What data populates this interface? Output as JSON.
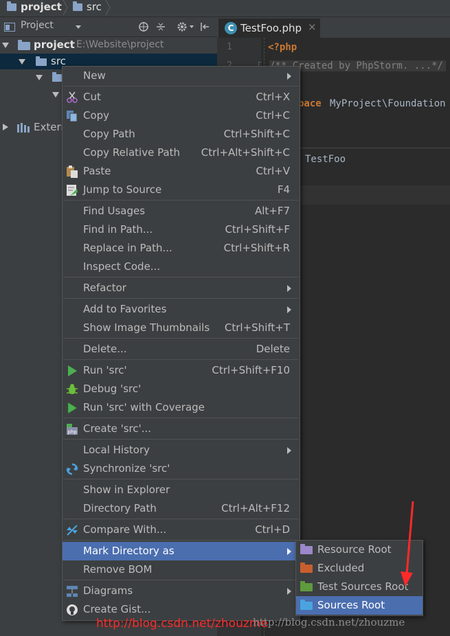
{
  "breadcrumb": {
    "project": "project",
    "src": "src"
  },
  "project_panel": {
    "view_label": "Project",
    "tree": {
      "root_name": "project",
      "root_path": "E:\\Website\\project",
      "src": "src",
      "external": "Extern"
    }
  },
  "editor": {
    "tab_name": "TestFoo.php",
    "tab_icon_letter": "C",
    "line_numbers": [
      "1",
      "2"
    ],
    "code": {
      "open_tag": "<?php",
      "comment": "/** Created by PhpStorm. ...*/",
      "ns_keyword": "pace",
      "ns_name": "MyProject\\Foundation",
      "class_name": "TestFoo"
    }
  },
  "context_menu": {
    "items": [
      {
        "label": "New",
        "shortcut": ""
      },
      {
        "label": "Cut",
        "shortcut": "Ctrl+X"
      },
      {
        "label": "Copy",
        "shortcut": "Ctrl+C"
      },
      {
        "label": "Copy Path",
        "shortcut": "Ctrl+Shift+C"
      },
      {
        "label": "Copy Relative Path",
        "shortcut": "Ctrl+Alt+Shift+C"
      },
      {
        "label": "Paste",
        "shortcut": "Ctrl+V"
      },
      {
        "label": "Jump to Source",
        "shortcut": "F4"
      },
      {
        "label": "Find Usages",
        "shortcut": "Alt+F7"
      },
      {
        "label": "Find in Path...",
        "shortcut": "Ctrl+Shift+F"
      },
      {
        "label": "Replace in Path...",
        "shortcut": "Ctrl+Shift+R"
      },
      {
        "label": "Inspect Code...",
        "shortcut": ""
      },
      {
        "label": "Refactor",
        "shortcut": ""
      },
      {
        "label": "Add to Favorites",
        "shortcut": ""
      },
      {
        "label": "Show Image Thumbnails",
        "shortcut": "Ctrl+Shift+T"
      },
      {
        "label": "Delete...",
        "shortcut": "Delete"
      },
      {
        "label": "Run 'src'",
        "shortcut": "Ctrl+Shift+F10"
      },
      {
        "label": "Debug 'src'",
        "shortcut": ""
      },
      {
        "label": "Run 'src' with Coverage",
        "shortcut": ""
      },
      {
        "label": "Create 'src'...",
        "shortcut": ""
      },
      {
        "label": "Local History",
        "shortcut": ""
      },
      {
        "label": "Synchronize 'src'",
        "shortcut": ""
      },
      {
        "label": "Show in Explorer",
        "shortcut": ""
      },
      {
        "label": "Directory Path",
        "shortcut": "Ctrl+Alt+F12"
      },
      {
        "label": "Compare With...",
        "shortcut": "Ctrl+D"
      },
      {
        "label": "Mark Directory as",
        "shortcut": ""
      },
      {
        "label": "Remove BOM",
        "shortcut": ""
      },
      {
        "label": "Diagrams",
        "shortcut": ""
      },
      {
        "label": "Create Gist...",
        "shortcut": ""
      }
    ]
  },
  "submenu": {
    "items": [
      {
        "label": "Resource Root",
        "color": "#9b87c9"
      },
      {
        "label": "Excluded",
        "color": "#c75f2e"
      },
      {
        "label": "Test Sources Root",
        "color": "#5f9a3d"
      },
      {
        "label": "Sources Root",
        "color": "#4aa3df"
      }
    ]
  },
  "watermarks": {
    "red": "http://blog.csdn.net/zhouzme",
    "gray": "http://blog.csdn.net/zhouzme"
  },
  "colors": {
    "highlight": "#4b6eaf",
    "arrow": "#ff2a2a"
  }
}
